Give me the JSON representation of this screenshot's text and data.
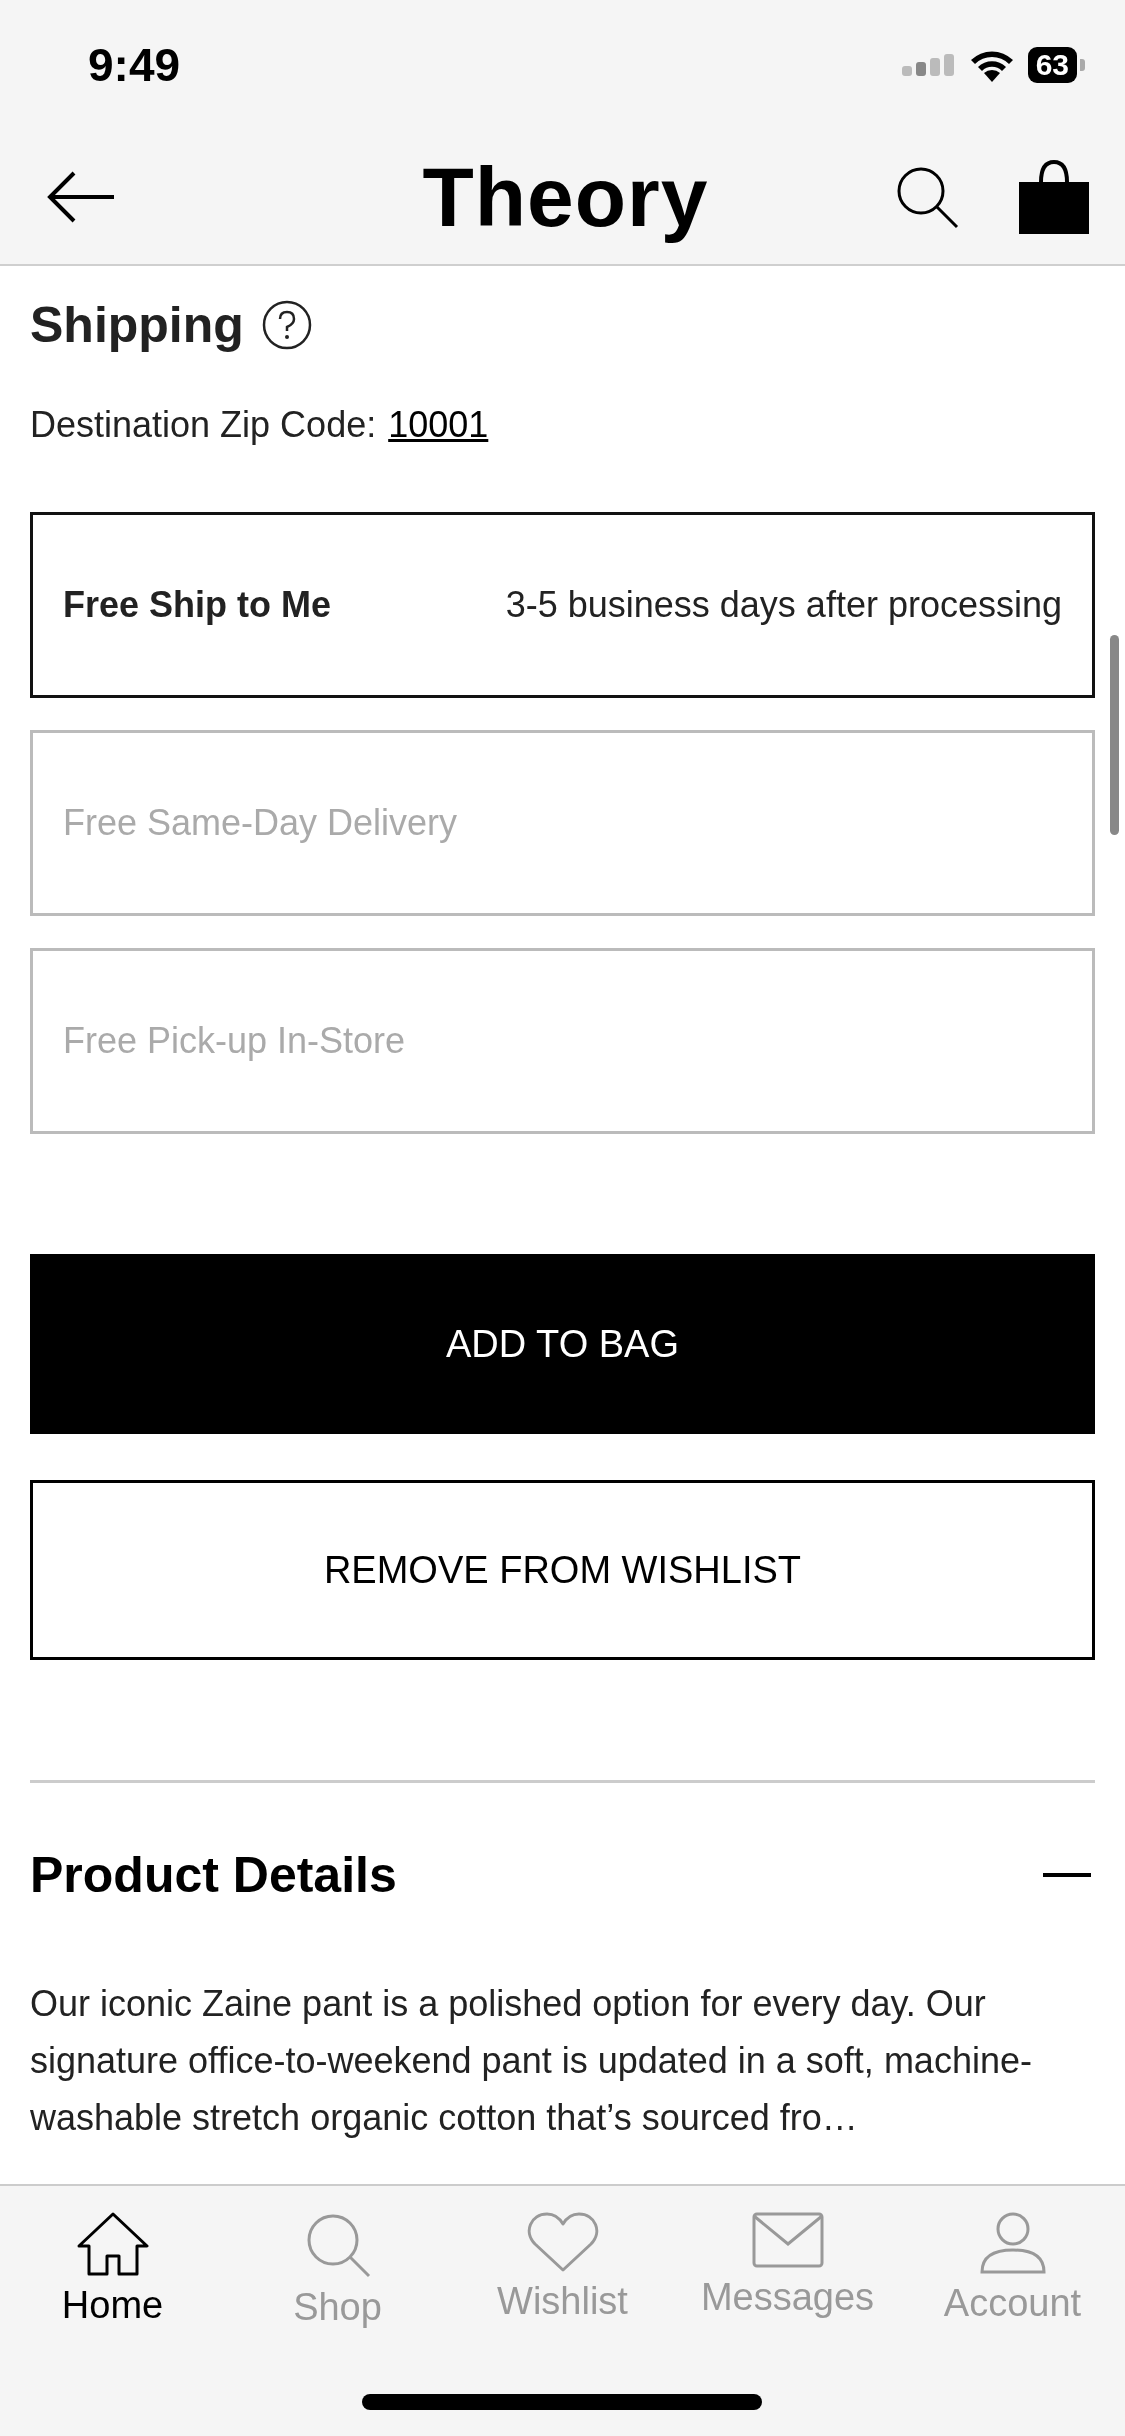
{
  "status_bar": {
    "time": "9:49",
    "battery": "63"
  },
  "header": {
    "title": "Theory"
  },
  "shipping": {
    "title": "Shipping",
    "zip_label": "Destination Zip Code:",
    "zip": "10001",
    "options": [
      {
        "label": "Free Ship to Me",
        "detail": "3-5 business days after processing",
        "selected": true
      },
      {
        "label": "Free Same-Day Delivery",
        "selected": false
      },
      {
        "label": "Free Pick-up In-Store",
        "selected": false
      }
    ]
  },
  "buttons": [
    {
      "label": "ADD TO BAG",
      "kind": "primary"
    },
    {
      "label": "REMOVE FROM WISHLIST",
      "kind": "secondary"
    }
  ],
  "product_details": {
    "title": "Product Details",
    "text": "Our iconic Zaine pant is a polished option for every day. Our signature office-to-weekend pant is updated in a soft, machine-washable stretch organic cotton that’s sourced fro…"
  },
  "tab_bar": [
    {
      "label": "Home",
      "kind": "home",
      "selected": true
    },
    {
      "label": "Shop",
      "kind": "search",
      "selected": false
    },
    {
      "label": "Wishlist",
      "kind": "heart",
      "selected": false
    },
    {
      "label": "Messages",
      "kind": "mail",
      "selected": false
    },
    {
      "label": "Account",
      "kind": "person",
      "selected": false
    }
  ]
}
